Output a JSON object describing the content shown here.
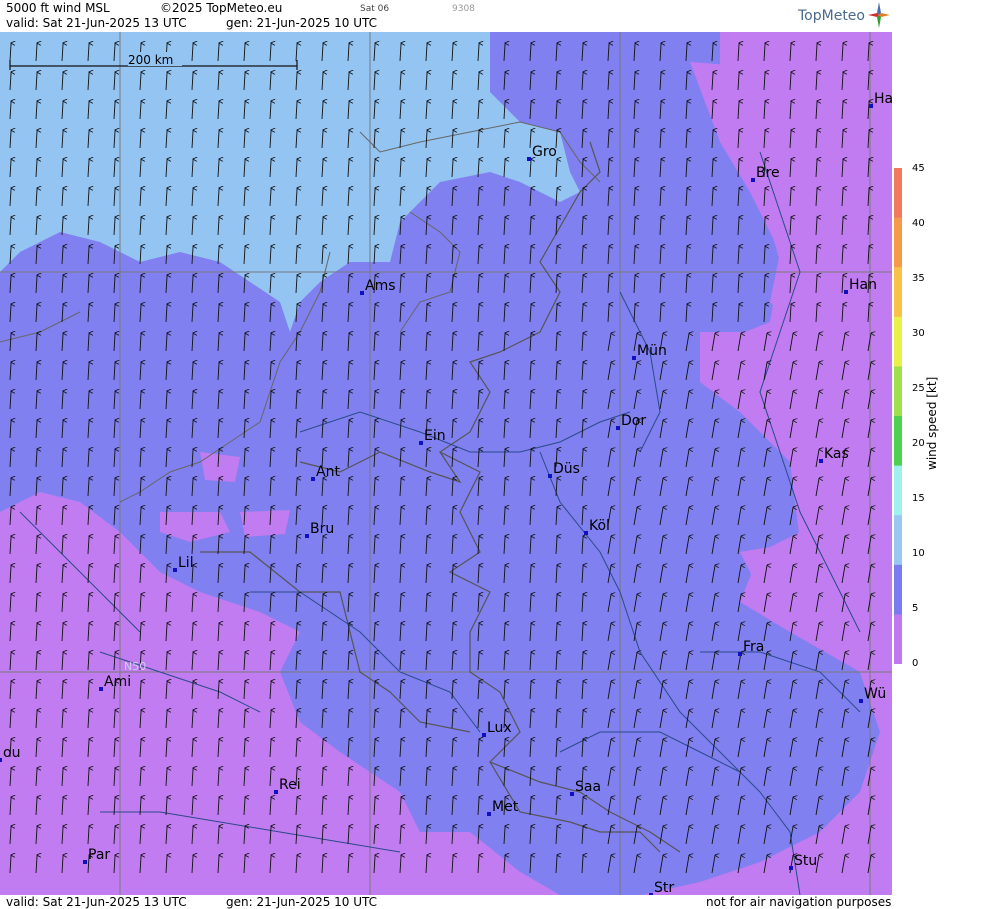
{
  "header": {
    "product": "5000 ft wind MSL",
    "copyright": "©2025 TopMeteo.eu",
    "day_code": "Sat 06",
    "run_code": "9308",
    "valid": "valid:  Sat  21-Jun-2025  13 UTC",
    "gen": "gen: 21-Jun-2025 10 UTC",
    "logo": "TopMeteo"
  },
  "footer": {
    "valid": "valid:  Sat  21-Jun-2025  13 UTC",
    "gen": "gen: 21-Jun-2025 10 UTC",
    "disclaimer": "not for air navigation purposes"
  },
  "map": {
    "scale_label": "200 km",
    "latitude_label": "N50",
    "cities": [
      {
        "label": "Ha"
      },
      {
        "label": "Gro"
      },
      {
        "label": "Bre"
      },
      {
        "label": "Ams"
      },
      {
        "label": "Han"
      },
      {
        "label": "Mün"
      },
      {
        "label": "Dor"
      },
      {
        "label": "Ein"
      },
      {
        "label": "Kas"
      },
      {
        "label": "Ant"
      },
      {
        "label": "Düs"
      },
      {
        "label": "Bru"
      },
      {
        "label": "Köl"
      },
      {
        "label": "Lil"
      },
      {
        "label": "Fra"
      },
      {
        "label": "Ami"
      },
      {
        "label": "Wü"
      },
      {
        "label": "Lux"
      },
      {
        "label": "ou"
      },
      {
        "label": "Rei"
      },
      {
        "label": "Saa"
      },
      {
        "label": "Met"
      },
      {
        "label": "Par"
      },
      {
        "label": "Stu"
      },
      {
        "label": "Str"
      }
    ]
  },
  "legend": {
    "unit": "wind  speed  [kt]",
    "ticks": [
      "45",
      "40",
      "35",
      "30",
      "25",
      "20",
      "15",
      "10",
      "5",
      "0"
    ],
    "colors": [
      "#f07a60",
      "#f59a4a",
      "#f8c24a",
      "#eaf04a",
      "#a0e050",
      "#50d050",
      "#a0f0f0",
      "#9ac8f0",
      "#7b7bf0",
      "#c078f0"
    ]
  },
  "colors": {
    "light_blue": "#94c4f2",
    "blue": "#8080f0",
    "violet": "#c07cf0",
    "border": "#555555",
    "river": "#2a4a8a",
    "grid": "#7a7a7a"
  }
}
